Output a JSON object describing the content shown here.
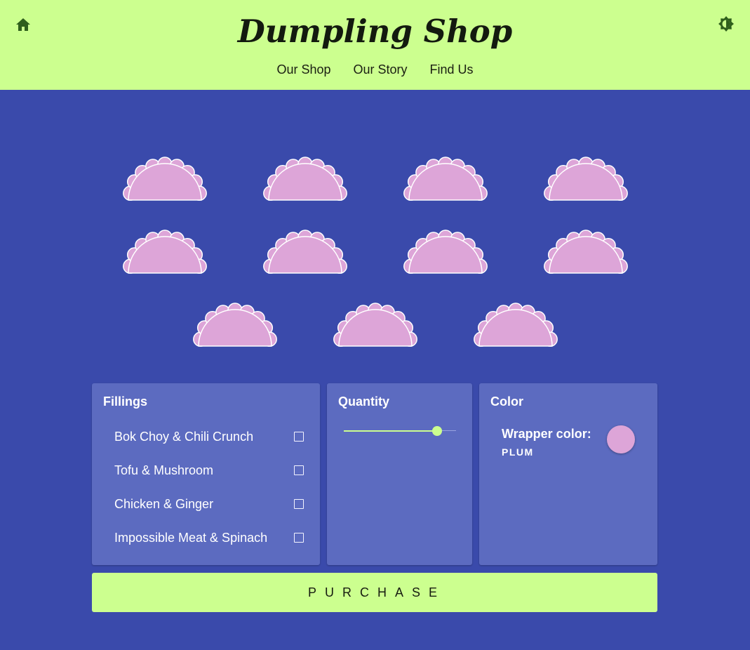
{
  "header": {
    "title": "Dumpling Shop",
    "nav": [
      "Our Shop",
      "Our Story",
      "Find Us"
    ],
    "home_icon": "home-icon",
    "theme_icon": "brightness-icon"
  },
  "colors": {
    "header_bg": "#ccff8f",
    "page_bg": "#3a4aab",
    "panel_bg": "#5c6bc0",
    "accent": "#ccff8f",
    "wrapper": "#dda5d8",
    "icon": "#2e5e1c"
  },
  "dumplings": {
    "count": 11,
    "icon": "dumpling-icon"
  },
  "fillings": {
    "title": "Fillings",
    "options": [
      {
        "label": "Bok Choy & Chili Crunch",
        "checked": false
      },
      {
        "label": "Tofu & Mushroom",
        "checked": false
      },
      {
        "label": "Chicken & Ginger",
        "checked": false
      },
      {
        "label": "Impossible Meat & Spinach",
        "checked": false
      }
    ]
  },
  "quantity": {
    "title": "Quantity",
    "value": 11,
    "min": 1,
    "max": 13
  },
  "color": {
    "title": "Color",
    "wrapper_label": "Wrapper color:",
    "wrapper_value": "PLUM",
    "swatch": "#dda5d8"
  },
  "purchase_label": "PURCHASE"
}
